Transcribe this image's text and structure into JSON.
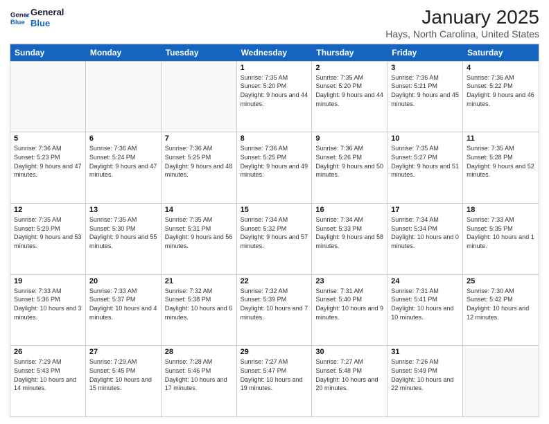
{
  "logo": {
    "line1": "General",
    "line2": "Blue"
  },
  "title": "January 2025",
  "location": "Hays, North Carolina, United States",
  "days_of_week": [
    "Sunday",
    "Monday",
    "Tuesday",
    "Wednesday",
    "Thursday",
    "Friday",
    "Saturday"
  ],
  "weeks": [
    [
      {
        "day": "",
        "sunrise": "",
        "sunset": "",
        "daylight": ""
      },
      {
        "day": "",
        "sunrise": "",
        "sunset": "",
        "daylight": ""
      },
      {
        "day": "",
        "sunrise": "",
        "sunset": "",
        "daylight": ""
      },
      {
        "day": "1",
        "sunrise": "Sunrise: 7:35 AM",
        "sunset": "Sunset: 5:20 PM",
        "daylight": "Daylight: 9 hours and 44 minutes."
      },
      {
        "day": "2",
        "sunrise": "Sunrise: 7:35 AM",
        "sunset": "Sunset: 5:20 PM",
        "daylight": "Daylight: 9 hours and 44 minutes."
      },
      {
        "day": "3",
        "sunrise": "Sunrise: 7:36 AM",
        "sunset": "Sunset: 5:21 PM",
        "daylight": "Daylight: 9 hours and 45 minutes."
      },
      {
        "day": "4",
        "sunrise": "Sunrise: 7:36 AM",
        "sunset": "Sunset: 5:22 PM",
        "daylight": "Daylight: 9 hours and 46 minutes."
      }
    ],
    [
      {
        "day": "5",
        "sunrise": "Sunrise: 7:36 AM",
        "sunset": "Sunset: 5:23 PM",
        "daylight": "Daylight: 9 hours and 47 minutes."
      },
      {
        "day": "6",
        "sunrise": "Sunrise: 7:36 AM",
        "sunset": "Sunset: 5:24 PM",
        "daylight": "Daylight: 9 hours and 47 minutes."
      },
      {
        "day": "7",
        "sunrise": "Sunrise: 7:36 AM",
        "sunset": "Sunset: 5:25 PM",
        "daylight": "Daylight: 9 hours and 48 minutes."
      },
      {
        "day": "8",
        "sunrise": "Sunrise: 7:36 AM",
        "sunset": "Sunset: 5:25 PM",
        "daylight": "Daylight: 9 hours and 49 minutes."
      },
      {
        "day": "9",
        "sunrise": "Sunrise: 7:36 AM",
        "sunset": "Sunset: 5:26 PM",
        "daylight": "Daylight: 9 hours and 50 minutes."
      },
      {
        "day": "10",
        "sunrise": "Sunrise: 7:35 AM",
        "sunset": "Sunset: 5:27 PM",
        "daylight": "Daylight: 9 hours and 51 minutes."
      },
      {
        "day": "11",
        "sunrise": "Sunrise: 7:35 AM",
        "sunset": "Sunset: 5:28 PM",
        "daylight": "Daylight: 9 hours and 52 minutes."
      }
    ],
    [
      {
        "day": "12",
        "sunrise": "Sunrise: 7:35 AM",
        "sunset": "Sunset: 5:29 PM",
        "daylight": "Daylight: 9 hours and 53 minutes."
      },
      {
        "day": "13",
        "sunrise": "Sunrise: 7:35 AM",
        "sunset": "Sunset: 5:30 PM",
        "daylight": "Daylight: 9 hours and 55 minutes."
      },
      {
        "day": "14",
        "sunrise": "Sunrise: 7:35 AM",
        "sunset": "Sunset: 5:31 PM",
        "daylight": "Daylight: 9 hours and 56 minutes."
      },
      {
        "day": "15",
        "sunrise": "Sunrise: 7:34 AM",
        "sunset": "Sunset: 5:32 PM",
        "daylight": "Daylight: 9 hours and 57 minutes."
      },
      {
        "day": "16",
        "sunrise": "Sunrise: 7:34 AM",
        "sunset": "Sunset: 5:33 PM",
        "daylight": "Daylight: 9 hours and 58 minutes."
      },
      {
        "day": "17",
        "sunrise": "Sunrise: 7:34 AM",
        "sunset": "Sunset: 5:34 PM",
        "daylight": "Daylight: 10 hours and 0 minutes."
      },
      {
        "day": "18",
        "sunrise": "Sunrise: 7:33 AM",
        "sunset": "Sunset: 5:35 PM",
        "daylight": "Daylight: 10 hours and 1 minute."
      }
    ],
    [
      {
        "day": "19",
        "sunrise": "Sunrise: 7:33 AM",
        "sunset": "Sunset: 5:36 PM",
        "daylight": "Daylight: 10 hours and 3 minutes."
      },
      {
        "day": "20",
        "sunrise": "Sunrise: 7:33 AM",
        "sunset": "Sunset: 5:37 PM",
        "daylight": "Daylight: 10 hours and 4 minutes."
      },
      {
        "day": "21",
        "sunrise": "Sunrise: 7:32 AM",
        "sunset": "Sunset: 5:38 PM",
        "daylight": "Daylight: 10 hours and 6 minutes."
      },
      {
        "day": "22",
        "sunrise": "Sunrise: 7:32 AM",
        "sunset": "Sunset: 5:39 PM",
        "daylight": "Daylight: 10 hours and 7 minutes."
      },
      {
        "day": "23",
        "sunrise": "Sunrise: 7:31 AM",
        "sunset": "Sunset: 5:40 PM",
        "daylight": "Daylight: 10 hours and 9 minutes."
      },
      {
        "day": "24",
        "sunrise": "Sunrise: 7:31 AM",
        "sunset": "Sunset: 5:41 PM",
        "daylight": "Daylight: 10 hours and 10 minutes."
      },
      {
        "day": "25",
        "sunrise": "Sunrise: 7:30 AM",
        "sunset": "Sunset: 5:42 PM",
        "daylight": "Daylight: 10 hours and 12 minutes."
      }
    ],
    [
      {
        "day": "26",
        "sunrise": "Sunrise: 7:29 AM",
        "sunset": "Sunset: 5:43 PM",
        "daylight": "Daylight: 10 hours and 14 minutes."
      },
      {
        "day": "27",
        "sunrise": "Sunrise: 7:29 AM",
        "sunset": "Sunset: 5:45 PM",
        "daylight": "Daylight: 10 hours and 15 minutes."
      },
      {
        "day": "28",
        "sunrise": "Sunrise: 7:28 AM",
        "sunset": "Sunset: 5:46 PM",
        "daylight": "Daylight: 10 hours and 17 minutes."
      },
      {
        "day": "29",
        "sunrise": "Sunrise: 7:27 AM",
        "sunset": "Sunset: 5:47 PM",
        "daylight": "Daylight: 10 hours and 19 minutes."
      },
      {
        "day": "30",
        "sunrise": "Sunrise: 7:27 AM",
        "sunset": "Sunset: 5:48 PM",
        "daylight": "Daylight: 10 hours and 20 minutes."
      },
      {
        "day": "31",
        "sunrise": "Sunrise: 7:26 AM",
        "sunset": "Sunset: 5:49 PM",
        "daylight": "Daylight: 10 hours and 22 minutes."
      },
      {
        "day": "",
        "sunrise": "",
        "sunset": "",
        "daylight": ""
      }
    ]
  ]
}
